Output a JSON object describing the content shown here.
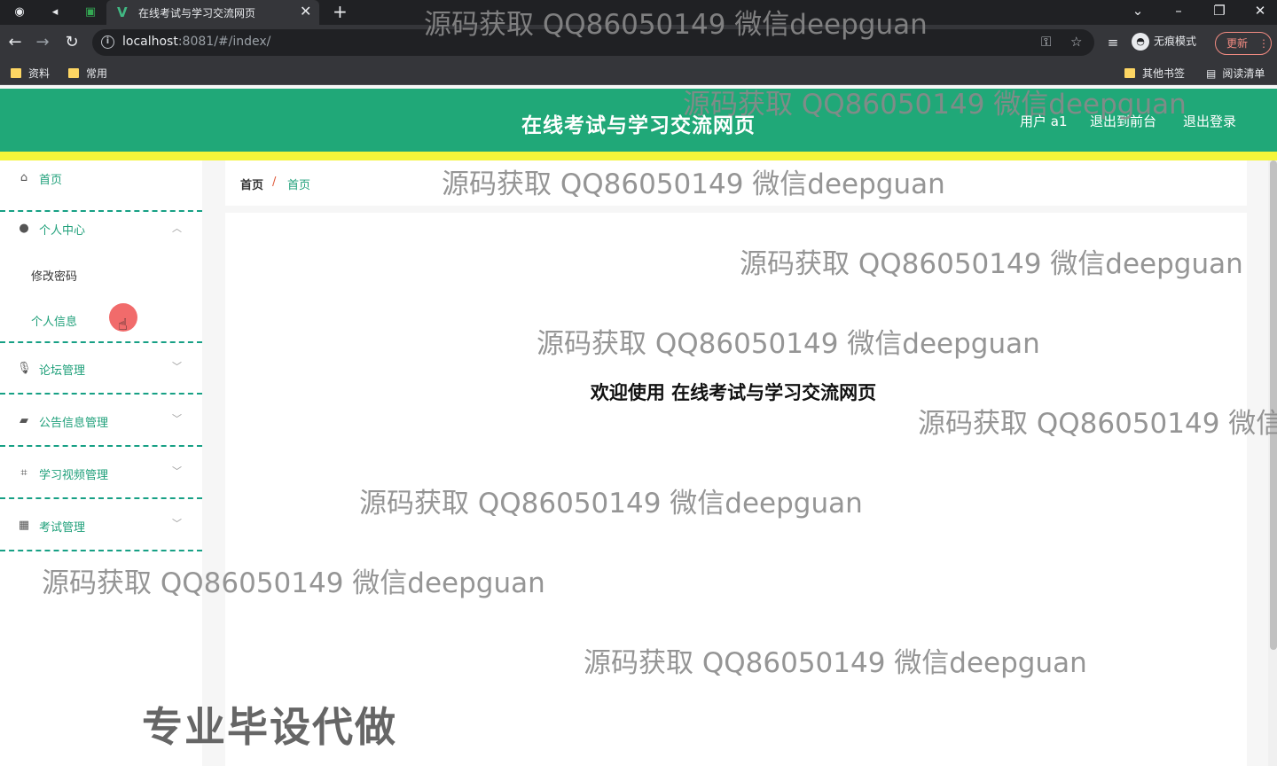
{
  "browser": {
    "tab_title": "在线考试与学习交流网页",
    "url_host": "localhost",
    "url_rest": ":8081/#/index/",
    "incognito_label": "无痕模式",
    "update_label": "更新",
    "bookmarks": [
      "资料",
      "常用"
    ],
    "bookmarks_right": [
      "其他书签",
      "阅读清单"
    ]
  },
  "header": {
    "title": "在线考试与学习交流网页",
    "user": "用户 a1",
    "to_frontend": "退出到前台",
    "logout": "退出登录",
    "color": "#20a878",
    "band_color": "#f5f53a"
  },
  "sidebar": {
    "home": "首页",
    "personal_center": "个人中心",
    "change_password": "修改密码",
    "personal_info": "个人信息",
    "forum": "论坛管理",
    "notice": "公告信息管理",
    "video": "学习视频管理",
    "exam": "考试管理"
  },
  "breadcrumb": {
    "root": "首页",
    "sep": "/",
    "current": "首页"
  },
  "main": {
    "welcome": "欢迎使用 在线考试与学习交流网页"
  },
  "overlay": {
    "watermark": "源码获取 QQ86050149 微信deepguan",
    "promo": "专业毕设代做"
  },
  "icons": {
    "home": "house-icon",
    "personal": "person-icon",
    "forum": "microphone-icon",
    "notice": "notice-icon",
    "video": "crop-icon",
    "exam": "ticket-icon"
  }
}
